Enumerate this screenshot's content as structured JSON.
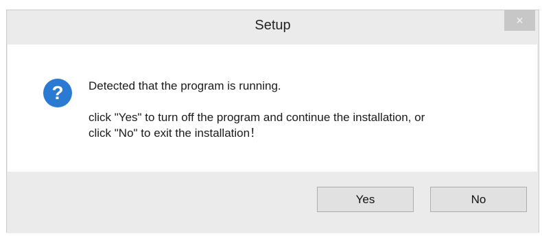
{
  "window": {
    "title": "Setup",
    "close_glyph": "×"
  },
  "message": {
    "icon": "question-icon",
    "line1": "Detected that the program is running.",
    "line2": "click \"Yes\" to turn off the program and continue the installation, or",
    "line3": "click \"No\" to exit the installation！"
  },
  "buttons": {
    "yes_label": "Yes",
    "no_label": "No"
  },
  "colors": {
    "icon_blue": "#2a7ad4",
    "dialog_gray": "#ebebeb",
    "content_white": "#ffffff"
  }
}
